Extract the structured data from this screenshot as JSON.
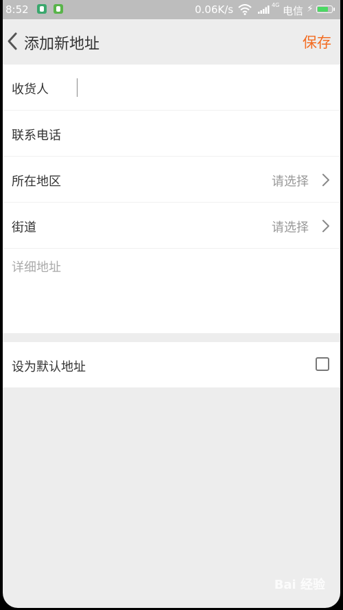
{
  "status_bar": {
    "time": "8:52",
    "network_speed": "0.06K/s",
    "network_type": "4G",
    "carrier": "电信"
  },
  "header": {
    "title": "添加新地址",
    "save_label": "保存",
    "accent_color": "#f36c21"
  },
  "form": {
    "recipient_label": "收货人",
    "phone_label": "联系电话",
    "region_label": "所在地区",
    "region_value": "请选择",
    "street_label": "街道",
    "street_value": "请选择",
    "detail_placeholder": "详细地址"
  },
  "default_option": {
    "label": "设为默认地址",
    "checked": false
  },
  "watermark": "Bai 经验"
}
